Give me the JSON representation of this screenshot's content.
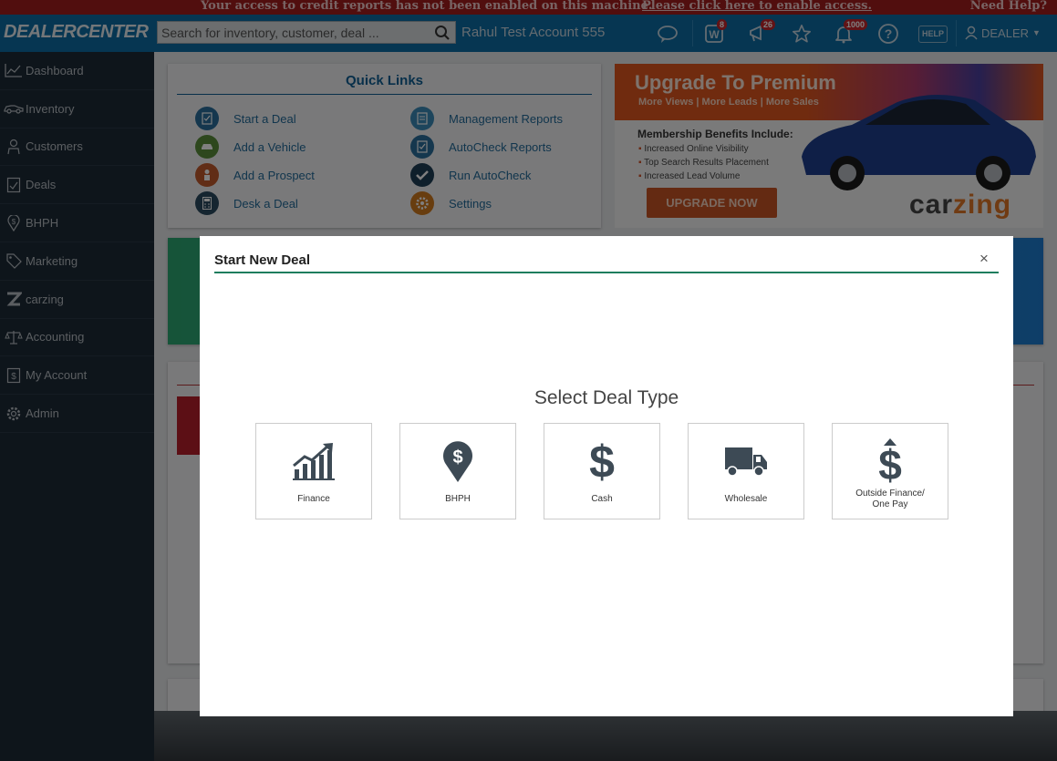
{
  "alert": {
    "message": "Your access to credit reports has not been enabled on this machine.",
    "link": "Please click here to enable access.",
    "help": "Need Help?"
  },
  "header": {
    "logo": "DEALERCENTER",
    "search_placeholder": "Search for inventory, customer, deal ...",
    "account": "Rahul Test Account 555",
    "badges": {
      "w": "8",
      "megaphone": "26",
      "bell": "1000"
    },
    "help_label": "HELP",
    "user": "DEALER"
  },
  "sidebar": {
    "items": [
      {
        "label": "Dashboard",
        "icon": "chart-line-icon"
      },
      {
        "label": "Inventory",
        "icon": "car-icon"
      },
      {
        "label": "Customers",
        "icon": "user-icon"
      },
      {
        "label": "Deals",
        "icon": "document-icon"
      },
      {
        "label": "BHPH",
        "icon": "dollar-pin-icon"
      },
      {
        "label": "Marketing",
        "icon": "tag-icon"
      },
      {
        "label": "carzing",
        "icon": "carzing-logo-icon"
      },
      {
        "label": "Accounting",
        "icon": "scale-icon"
      },
      {
        "label": "My Account",
        "icon": "dollar-doc-icon"
      },
      {
        "label": "Admin",
        "icon": "gear-icon"
      }
    ]
  },
  "quick_links": {
    "title": "Quick Links",
    "items": [
      {
        "label": "Start a Deal",
        "color": "#2a6e9c"
      },
      {
        "label": "Add a Vehicle",
        "color": "#5a8f3a"
      },
      {
        "label": "Add a Prospect",
        "color": "#c25b2c"
      },
      {
        "label": "Desk a Deal",
        "color": "#2a4a60"
      },
      {
        "label": "Management Reports",
        "color": "#3a8ab8"
      },
      {
        "label": "AutoCheck Reports",
        "color": "#2a6e9c"
      },
      {
        "label": "Run AutoCheck",
        "color": "#1f3e57"
      },
      {
        "label": "Settings",
        "color": "#d17a1f"
      }
    ]
  },
  "promo": {
    "title": "Upgrade To Premium",
    "subtitle": "More Views  |  More Leads  |  More Sales",
    "benefits_title": "Membership Benefits Include:",
    "benefits": [
      "Increased Online Visibility",
      "Top Search Results Placement",
      "Increased Lead Volume"
    ],
    "button": "UPGRADE NOW",
    "brand_a": "car",
    "brand_b": "zing"
  },
  "modal": {
    "title": "Start New Deal",
    "close": "×",
    "heading": "Select Deal Type",
    "options": [
      {
        "label": "Finance",
        "icon": "chart-growth-icon"
      },
      {
        "label": "BHPH",
        "icon": "dollar-pin-icon"
      },
      {
        "label": "Cash",
        "icon": "dollar-icon"
      },
      {
        "label": "Wholesale",
        "icon": "truck-icon"
      },
      {
        "label_line1": "Outside Finance/",
        "label_line2": "One Pay",
        "icon": "dollar-arrow-icon"
      }
    ]
  },
  "colors": {
    "header": "#1a8fd4",
    "sidebar": "#2e4256",
    "modal_rule": "#1e7d5e",
    "alert": "#d02626"
  }
}
